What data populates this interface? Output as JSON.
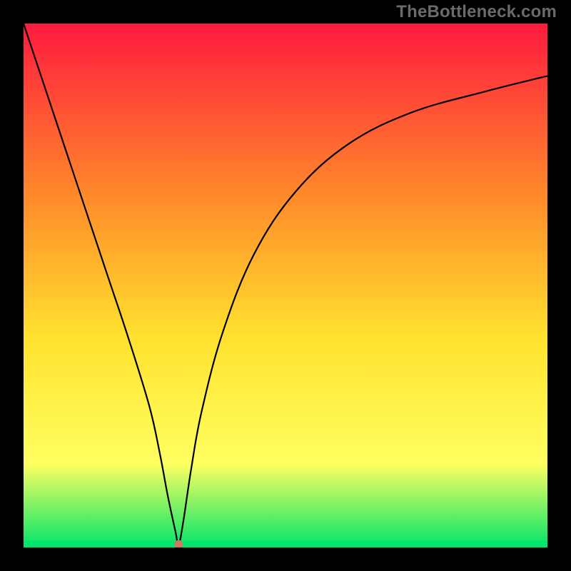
{
  "watermark": "TheBottleneck.com",
  "chart_data": {
    "type": "line",
    "title": "",
    "xlabel": "",
    "ylabel": "",
    "xlim": [
      0,
      100
    ],
    "ylim": [
      0,
      100
    ],
    "grid": false,
    "legend": false,
    "background_gradient": {
      "stops": [
        {
          "pos": 0.0,
          "color": "#ff1a3f"
        },
        {
          "pos": 0.33,
          "color": "#ff8a2a"
        },
        {
          "pos": 0.6,
          "color": "#ffe22e"
        },
        {
          "pos": 0.84,
          "color": "#ffff60"
        },
        {
          "pos": 1.0,
          "color": "#00e56a"
        }
      ]
    },
    "series": [
      {
        "name": "bottleneck-curve",
        "color": "#000000",
        "x": [
          0.0,
          4.0,
          8.0,
          12.0,
          16.0,
          20.0,
          24.0,
          26.0,
          27.5,
          29.0,
          29.6,
          30.5,
          32.0,
          34.0,
          38.0,
          44.0,
          52.0,
          62.0,
          74.0,
          88.0,
          100.0
        ],
        "values": [
          100,
          88,
          76,
          64,
          52,
          40,
          27,
          18,
          10,
          3,
          0.5,
          5,
          15,
          26,
          41,
          56,
          68,
          77,
          83,
          87,
          90
        ]
      }
    ],
    "marker": {
      "name": "min-point",
      "x": 29.6,
      "y": 0.6,
      "color": "#c97a63",
      "radius_px": 6
    },
    "good_band": {
      "y_top": 1.2,
      "y_bottom": 0.0,
      "color": "#00e56a"
    }
  }
}
